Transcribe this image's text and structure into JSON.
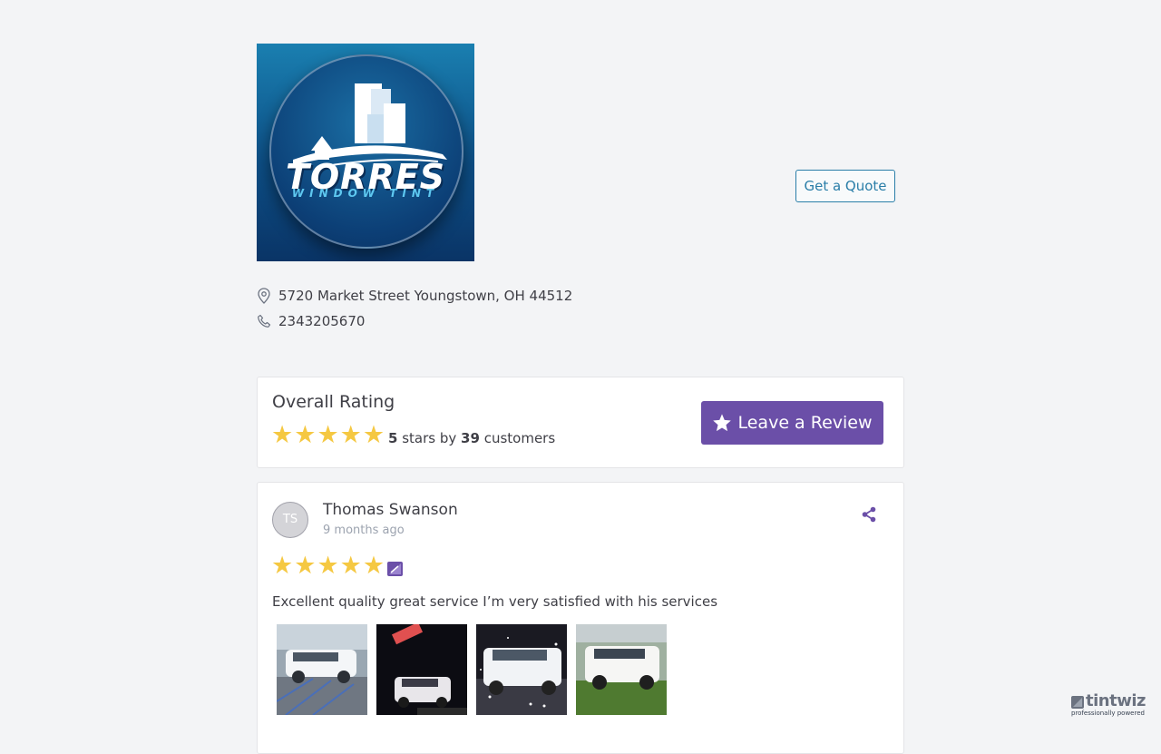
{
  "business": {
    "logo_name": "TORRES",
    "logo_tagline": "WINDOW TINT",
    "address": "5720 Market Street Youngstown, OH 44512",
    "phone": "2343205670"
  },
  "header": {
    "quote_label": "Get a Quote"
  },
  "rating": {
    "title": "Overall Rating",
    "stars": 5,
    "stars_value": "5",
    "stars_text": "stars by",
    "customers_value": "39",
    "customers_text": "customers",
    "review_button_label": "Leave a Review"
  },
  "review": {
    "initials": "TS",
    "name": "Thomas Swanson",
    "date": "9 months ago",
    "stars": 5,
    "text": "Excellent quality great service I’m very satisfied with his services",
    "photos": [
      "white-suv-parking-lot",
      "white-suv-night",
      "white-suv-sparkles",
      "white-suv-grass"
    ]
  },
  "footer": {
    "brand": "tintwiz",
    "tagline": "professionally powered"
  },
  "colors": {
    "accent": "#6b4fa8",
    "link": "#2a7ea8",
    "star": "#f5c842"
  }
}
